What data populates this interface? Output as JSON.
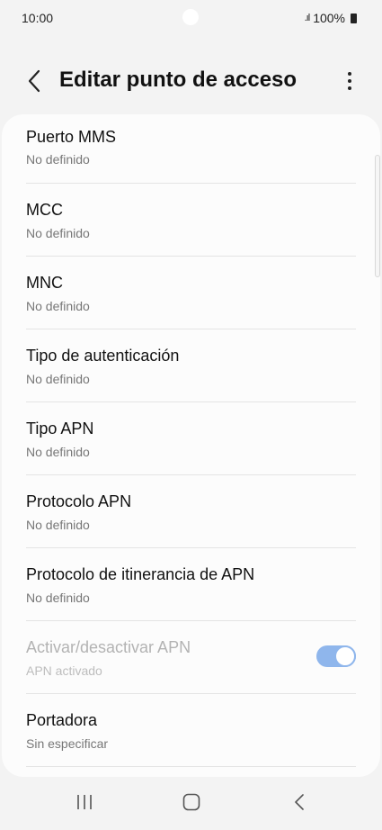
{
  "status_bar": {
    "time": "10:00",
    "signal": ".ıl",
    "battery": "100%"
  },
  "header": {
    "title": "Editar punto de acceso"
  },
  "items": [
    {
      "label": "Puerto MMS",
      "value": "No definido"
    },
    {
      "label": "MCC",
      "value": "No definido"
    },
    {
      "label": "MNC",
      "value": "No definido"
    },
    {
      "label": "Tipo de autenticación",
      "value": "No definido"
    },
    {
      "label": "Tipo APN",
      "value": "No definido"
    },
    {
      "label": "Protocolo APN",
      "value": "No definido"
    },
    {
      "label": "Protocolo de itinerancia de APN",
      "value": "No definido"
    },
    {
      "label": "Activar/desactivar APN",
      "value": "APN activado",
      "toggle_on": true,
      "disabled": true
    },
    {
      "label": "Portadora",
      "value": "Sin especificar"
    }
  ],
  "colors": {
    "background": "#f3f3f3",
    "card": "#fcfcfc",
    "toggle_accent": "#8fb6ec"
  },
  "icons": {
    "back": "chevron-left-icon",
    "more": "more-vertical-icon",
    "recents": "recents-icon",
    "home": "home-icon",
    "nav_back": "nav-back-icon"
  }
}
